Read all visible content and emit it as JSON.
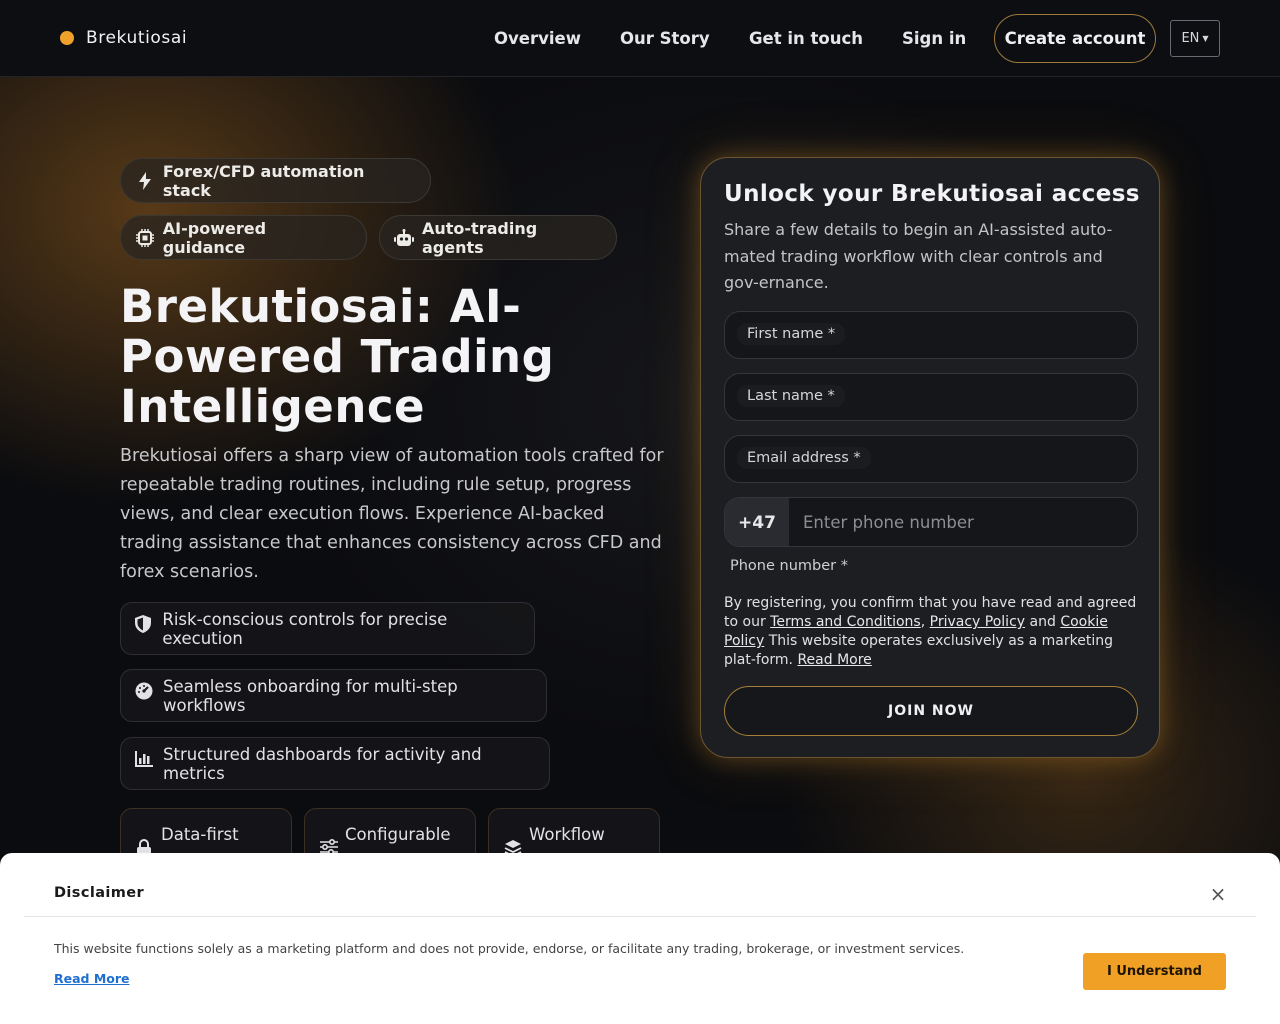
{
  "brand": {
    "name": "Brekutiosai"
  },
  "nav": {
    "overview": "Overview",
    "story": "Our Story",
    "contact": "Get in touch",
    "signin": "Sign in",
    "create": "Create account",
    "lang": "EN"
  },
  "colors": {
    "accent": "#f0a12a",
    "background": "#0c0d10",
    "card": "#1d1e22",
    "disclaimer_bg": "#ffffff",
    "link": "#1e6fd0"
  },
  "hero": {
    "pills": [
      {
        "label": "Forex/CFD automation stack",
        "icon": "bolt-icon"
      },
      {
        "label": "AI-powered guidance",
        "icon": "chip-icon"
      },
      {
        "label": "Auto-trading agents",
        "icon": "robot-icon"
      }
    ],
    "title": "Brekutiosai: AI-Powered Trading Intelligence",
    "description": "Brekutiosai offers a sharp view of automation tools crafted for repeatable trading routines, including rule setup, progress views, and clear execution flows. Experience AI-backed trading assistance that enhances consistency across CFD and forex scenarios.",
    "features": [
      {
        "label": "Risk-conscious controls for precise execution",
        "icon": "shield-icon"
      },
      {
        "label": "Seamless onboarding for multi-step workflows",
        "icon": "gauge-icon"
      },
      {
        "label": "Structured dashboards for activity and metrics",
        "icon": "bar-chart-icon"
      }
    ],
    "tiles": [
      {
        "label": "Data-first",
        "icon": "lock-icon"
      },
      {
        "label": "Configurable",
        "icon": "sliders-icon"
      },
      {
        "label": "Workflow",
        "icon": "layers-icon"
      }
    ]
  },
  "form": {
    "title": "Unlock your Brekutiosai access",
    "subtitle": "Share a few details to begin an AI-assisted auto-mated trading workflow with clear controls and gov-ernance.",
    "first_name": "First name *",
    "last_name": "Last name *",
    "email": "Email address *",
    "phone_code": "+47",
    "phone_placeholder": "Enter phone number",
    "phone_label": "Phone number *",
    "legal": {
      "prefix": "By registering, you confirm that you have read and agreed to our ",
      "terms": "Terms and Conditions",
      "comma": ", ",
      "privacy": "Privacy Policy",
      "and": " and ",
      "cookie": "Cookie Policy",
      "suffix": " This website operates exclusively as a marketing plat-form. ",
      "read_more": "Read More"
    },
    "submit": "JOIN NOW"
  },
  "disclaimer": {
    "title": "Disclaimer",
    "text": "This website functions solely as a marketing platform and does not provide, endorse, or facilitate any trading, brokerage, or investment services.",
    "read_more": "Read More",
    "button": "I Understand",
    "close": "×"
  }
}
